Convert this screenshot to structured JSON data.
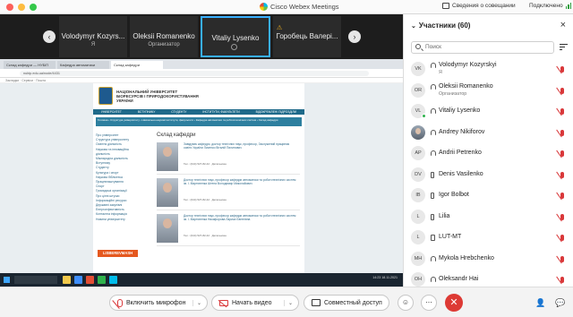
{
  "app": {
    "title": "Cisco Webex Meetings",
    "meeting_info": "Сведения о совещании",
    "status": "Подключено"
  },
  "filmstrip": {
    "tiles": [
      {
        "name": "Volodymyr Kozyrs...",
        "sub": "Я"
      },
      {
        "name": "Oleksii Romanenko",
        "sub": "Организатор"
      },
      {
        "name": "Vitaliy Lysenko",
        "sub": ""
      },
      {
        "name": "Горобець Валері...",
        "sub": ""
      }
    ],
    "prev_icon": "‹",
    "next_icon": "›"
  },
  "browser": {
    "tabs": [
      "Склад кафедри — НУБіП",
      "Кафедра автоматики",
      "Склад кафедри"
    ],
    "url": "nubip.edu.ua/node/4431",
    "bookmarks": "Закладки · Сервіси · Пошта",
    "site": {
      "name": "НАЦІОНАЛЬНИЙ УНІВЕРСИТЕТ БІОРЕСУРСІВ І ПРИРОДОКОРИСТУВАННЯ УКРАЇНИ",
      "nav": [
        "УНІВЕРСИТЕТ",
        "ВСТУПНИКУ",
        "СТУДЕНТУ",
        "ІНСТИТУТИ, ФАКУЛЬТЕТИ",
        "ВІДОКРЕМЛЕНІ ПІДРОЗДІЛИ"
      ],
      "crumb": "Головна › Структура університету › Навчально-наукові інститути, факультети › Кафедра автоматики та робототехнічних систем › Склад кафедри",
      "menu": [
        "Про університет",
        "Структура університету",
        "Освітня діяльність",
        "Наукова та інноваційна діяльність",
        "Міжнародна діяльність",
        "Вступнику",
        "Студенту",
        "Культура і спорт",
        "Наукова бібліотека",
        "Працевлаштування",
        "Спорт",
        "Громадські організації",
        "Про цінні штучки",
        "Інформаційні ресурси",
        "Державні закупівлі",
        "Енергоефективність",
        "Контактна інформація",
        "Новини університету"
      ],
      "dept_title": "Склад кафедри",
      "staff": [
        {
          "text": "Завідувач кафедри, доктор технічних наук, професор, Заслужений працівник освіти України Лисенко Віталій Пилипович",
          "extra": "Тел.: (044) 527-82-42 · Детальніше"
        },
        {
          "text": "Доктор технічних наук, професор кафедри автоматики та робототехнічних систем ім. І. Мартиненка Штепа Володимир Миколайович",
          "extra": "Тел.: (044) 527-82-42 · Детальніше"
        },
        {
          "text": "Доктор технічних наук, професор кафедри автоматики та робототехнічних систем ім. І. Мартиненка Никифорова Лариса Євгенівна",
          "extra": "Тел.: (044) 527-82-42 · Детальніше"
        }
      ],
      "banner": "LISBEREVMASH"
    },
    "clock": "14:23\n18.11.2021"
  },
  "panel": {
    "title": "Участники (60)",
    "search_placeholder": "Поиск",
    "participants": [
      {
        "initials": "VK",
        "name": "Volodymyr Kozyrskyi",
        "role": "Я",
        "device": "headset",
        "online": false,
        "photo": false
      },
      {
        "initials": "OR",
        "name": "Oleksii Romanenko",
        "role": "Организатор",
        "device": "headset",
        "online": false,
        "photo": false
      },
      {
        "initials": "VL",
        "name": "Vitaliy Lysenko",
        "role": "",
        "device": "headset",
        "online": true,
        "photo": false
      },
      {
        "initials": "",
        "name": "Andrey Nikiforov",
        "role": "",
        "device": "headset",
        "online": false,
        "photo": true
      },
      {
        "initials": "AP",
        "name": "Andrii Petrenko",
        "role": "",
        "device": "headset",
        "online": false,
        "photo": false
      },
      {
        "initials": "DV",
        "name": "Denis Vasilenko",
        "role": "",
        "device": "phone",
        "online": false,
        "photo": false
      },
      {
        "initials": "IB",
        "name": "Igor Bolbot",
        "role": "",
        "device": "phone",
        "online": false,
        "photo": false
      },
      {
        "initials": "L",
        "name": "Lilia",
        "role": "",
        "device": "phone",
        "online": false,
        "photo": false
      },
      {
        "initials": "L",
        "name": "LUT-MT",
        "role": "",
        "device": "laptop",
        "online": false,
        "photo": false
      },
      {
        "initials": "MH",
        "name": "Mykola Hrebchenko",
        "role": "",
        "device": "headset",
        "online": false,
        "photo": false
      },
      {
        "initials": "OH",
        "name": "Oleksandr Hai",
        "role": "",
        "device": "headset",
        "online": false,
        "photo": false
      }
    ]
  },
  "controls": {
    "mic_label": "Включить микрофон",
    "video_label": "Начать видео",
    "share_label": "Совместный доступ",
    "dropdown_icon": "⌄",
    "emoji_icon": "☺",
    "more_icon": "⋯",
    "end_icon": "✕",
    "participants_icon": "👤",
    "chat_icon": "💬"
  },
  "colors": {
    "accent": "#39b0ff",
    "danger": "#dd3a34",
    "online": "#2fb24c"
  }
}
